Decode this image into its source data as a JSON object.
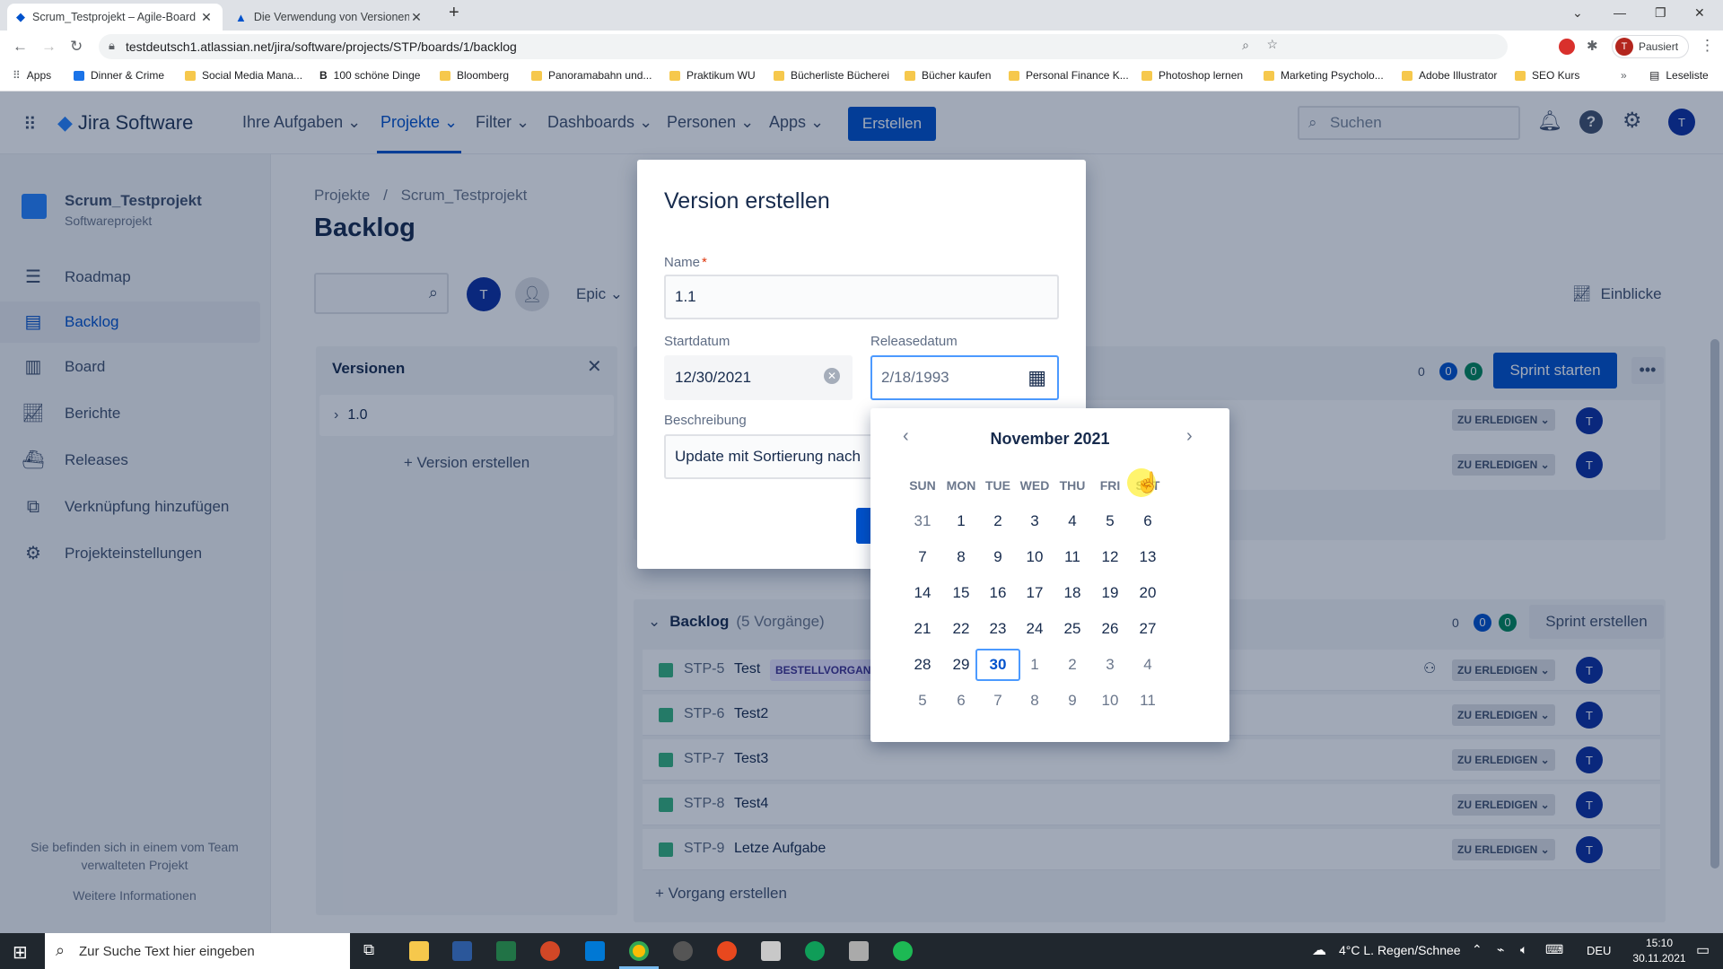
{
  "browser": {
    "tabs": [
      {
        "title": "Scrum_Testprojekt – Agile-Board"
      },
      {
        "title": "Die Verwendung von Versionen"
      }
    ],
    "url": "testdeutsch1.atlassian.net/jira/software/projects/STP/boards/1/backlog",
    "profile_label": "Pausiert",
    "bookmarks": [
      "Apps",
      "Dinner & Crime",
      "Social Media Mana...",
      "100 schöne Dinge",
      "Bloomberg",
      "Panoramabahn und...",
      "Praktikum WU",
      "Bücherliste Bücherei",
      "Bücher kaufen",
      "Personal Finance K...",
      "Photoshop lernen",
      "Marketing Psycholo...",
      "Adobe Illustrator",
      "SEO Kurs"
    ],
    "reading_list": "Leseliste"
  },
  "jira_nav": {
    "logo": "Jira Software",
    "items": [
      "Ihre Aufgaben",
      "Projekte",
      "Filter",
      "Dashboards",
      "Personen",
      "Apps"
    ],
    "create": "Erstellen",
    "search_placeholder": "Suchen",
    "user_initial": "T"
  },
  "sidebar": {
    "project_name": "Scrum_Testprojekt",
    "project_type": "Softwareprojekt",
    "items": [
      "Roadmap",
      "Backlog",
      "Board",
      "Berichte",
      "Releases",
      "Verknüpfung hinzufügen",
      "Projekteinstellungen"
    ],
    "footer_text": "Sie befinden sich in einem vom Team verwalteten Projekt",
    "footer_link": "Weitere Informationen"
  },
  "main": {
    "breadcrumb": [
      "Projekte",
      "/",
      "Scrum_Testprojekt"
    ],
    "title": "Backlog",
    "filter_avatar": "T",
    "epic": "Epic",
    "insights": "Einblicke",
    "versions_panel": {
      "title": "Versionen",
      "version": "1.0",
      "create": "+ Version erstellen"
    },
    "sprint": {
      "counts": [
        "0",
        "0",
        "0"
      ],
      "start": "Sprint starten",
      "statuses": [
        "ZU ERLEDIGEN",
        "ZU ERLEDIGEN"
      ]
    },
    "backlog": {
      "title": "Backlog",
      "count": "(5 Vorgänge)",
      "counts": [
        "0",
        "0",
        "0"
      ],
      "create_sprint": "Sprint erstellen",
      "issues": [
        {
          "key": "STP-5",
          "summary": "Test",
          "epic": "BESTELLVORGAN",
          "status": "ZU ERLEDIGEN",
          "avatar": "T"
        },
        {
          "key": "STP-6",
          "summary": "Test2",
          "status": "ZU ERLEDIGEN",
          "avatar": "T"
        },
        {
          "key": "STP-7",
          "summary": "Test3",
          "status": "ZU ERLEDIGEN",
          "avatar": "T"
        },
        {
          "key": "STP-8",
          "summary": "Test4",
          "status": "ZU ERLEDIGEN",
          "avatar": "T"
        },
        {
          "key": "STP-9",
          "summary": "Letze Aufgabe",
          "status": "ZU ERLEDIGEN",
          "avatar": "T"
        }
      ],
      "create_issue": "+ Vorgang erstellen"
    }
  },
  "modal": {
    "title": "Version erstellen",
    "name_label": "Name",
    "name_required": "*",
    "name_value": "1.1",
    "start_label": "Startdatum",
    "start_value": "12/30/2021",
    "release_label": "Releasedatum",
    "release_value": "2/18/1993",
    "desc_label": "Beschreibung",
    "desc_value": "Update mit Sortierung nach"
  },
  "calendar": {
    "month": "November 2021",
    "weekdays": [
      "SUN",
      "MON",
      "TUE",
      "WED",
      "THU",
      "FRI",
      "SAT"
    ],
    "weeks": [
      [
        "31",
        "1",
        "2",
        "3",
        "4",
        "5",
        "6"
      ],
      [
        "7",
        "8",
        "9",
        "10",
        "11",
        "12",
        "13"
      ],
      [
        "14",
        "15",
        "16",
        "17",
        "18",
        "19",
        "20"
      ],
      [
        "21",
        "22",
        "23",
        "24",
        "25",
        "26",
        "27"
      ],
      [
        "28",
        "29",
        "30",
        "1",
        "2",
        "3",
        "4"
      ],
      [
        "5",
        "6",
        "7",
        "8",
        "9",
        "10",
        "11"
      ]
    ],
    "today": "30"
  },
  "taskbar": {
    "search_placeholder": "Zur Suche Text hier eingeben",
    "weather": "4°C  L. Regen/Schnee",
    "lang": "DEU",
    "time": "15:10",
    "date": "30.11.2021"
  }
}
